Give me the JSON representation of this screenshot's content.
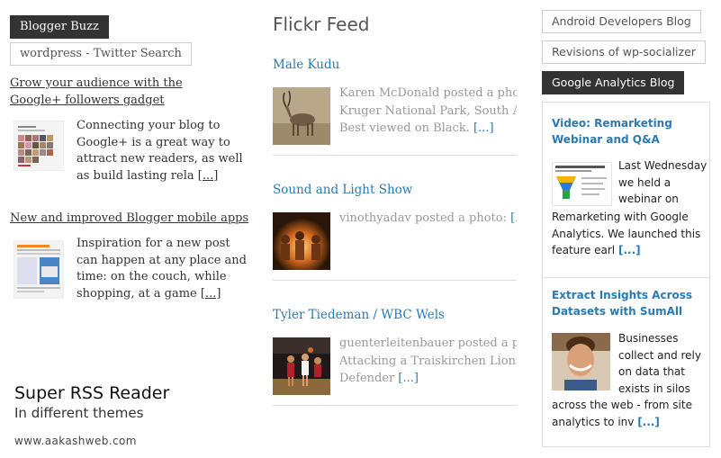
{
  "left_column": {
    "tabs": [
      {
        "label": "Blogger Buzz",
        "active": true
      },
      {
        "label": "wordpress - Twitter Search",
        "active": false
      }
    ],
    "posts": [
      {
        "title": "Grow your audience with the Google+ followers gadget",
        "excerpt": "Connecting your blog to Google+ is a great way to attract new readers, as well as build lasting rela",
        "more": "[...]"
      },
      {
        "title": "New and improved Blogger mobile apps",
        "excerpt": "Inspiration for a new post can happen at any place and time: on the couch, while shopping, at a game",
        "more": "[...]"
      }
    ]
  },
  "branding": {
    "title": "Super RSS Reader",
    "subtitle": "In different themes",
    "url": "www.aakashweb.com"
  },
  "flickr": {
    "heading": "Flickr Feed",
    "items": [
      {
        "title": "Male Kudu",
        "lines": [
          "Karen McDonald posted a photo",
          "Kruger National Park, South Afr",
          "Best viewed on Black."
        ],
        "more": "[...]"
      },
      {
        "title": "Sound and Light Show",
        "lines": [
          "vinothyadav posted a photo:"
        ],
        "more": "[..."
      },
      {
        "title": "Tyler Tiedeman / WBC Wels",
        "lines": [
          "guenterleitenbauer posted a photo",
          "Attacking a Traiskirchen Lions",
          "Defender"
        ],
        "more": "[...]"
      }
    ]
  },
  "right_column": {
    "tabs": [
      {
        "label": "Android Developers Blog",
        "active": false
      },
      {
        "label": "Revisions of wp-socializer",
        "active": false
      },
      {
        "label": "Google Analytics Blog",
        "active": true
      }
    ],
    "posts": [
      {
        "title": "Video: Remarketing Webinar and Q&A",
        "excerpt_side": [
          "Last Wednesday",
          "we held a",
          "webinar on"
        ],
        "excerpt_full": [
          "Remarketing with Google",
          "Analytics. We launched this",
          "feature earl"
        ],
        "more": "[...]"
      },
      {
        "title": "Extract Insights Across Datasets with SumAll",
        "excerpt_side": [
          "Businesses",
          "collect and rely",
          "on data that",
          "exists in silos"
        ],
        "excerpt_full": [
          "across the web - from site",
          "analytics to inv"
        ],
        "more": "[...]"
      }
    ]
  },
  "colors": {
    "accent_link": "#2a7ab3",
    "active_tab": "#333333"
  }
}
